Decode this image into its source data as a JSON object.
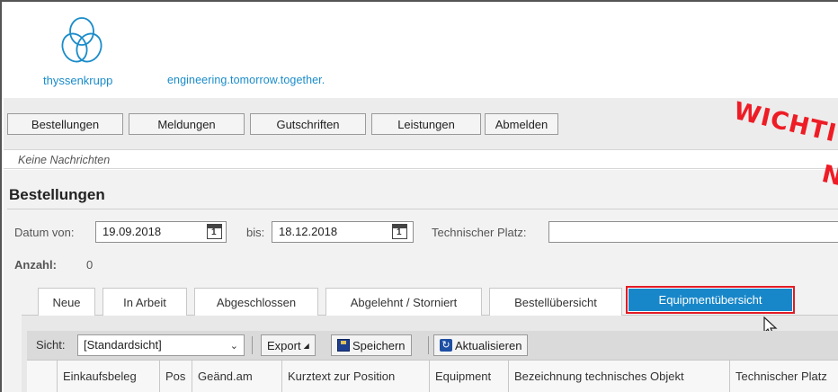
{
  "brand": {
    "name": "thyssenkrupp",
    "slogan": "engineering.tomorrow.together.",
    "color": "#1a8cc9"
  },
  "nav": {
    "items": [
      {
        "label": "Bestellungen"
      },
      {
        "label": "Meldungen"
      },
      {
        "label": "Gutschriften"
      },
      {
        "label": "Leistungen"
      },
      {
        "label": "Abmelden"
      }
    ]
  },
  "messages": {
    "text": "Keine Nachrichten"
  },
  "page": {
    "title": "Bestellungen"
  },
  "filters": {
    "date_from_label": "Datum von:",
    "date_from": "19.09.2018",
    "date_to_label": "bis:",
    "date_to": "18.12.2018",
    "calendar_day": "1",
    "tech_place_label": "Technischer Platz:",
    "tech_place_value": ""
  },
  "count": {
    "label": "Anzahl:",
    "value": "0"
  },
  "tabs": [
    {
      "label": "Neue"
    },
    {
      "label": "In Arbeit"
    },
    {
      "label": "Abgeschlossen"
    },
    {
      "label": "Abgelehnt / Storniert"
    },
    {
      "label": "Bestellübersicht"
    },
    {
      "label": "Equipmentübersicht",
      "active": true
    }
  ],
  "toolbar": {
    "view_label": "Sicht:",
    "view_value": "[Standardsicht]",
    "export_label": "Export",
    "save_label": "Speichern",
    "refresh_label": "Aktualisieren"
  },
  "table": {
    "columns": [
      "",
      "Einkaufsbeleg",
      "Pos",
      "Geänd.am",
      "Kurztext zur Position",
      "Equipment",
      "Bezeichnung technisches Objekt",
      "Technischer Platz"
    ]
  },
  "watermark": {
    "line1": "WICHTI",
    "line2": "N"
  },
  "colors": {
    "accent": "#1887c9",
    "highlight": "#e21b25",
    "watermark": "#ee1c25"
  }
}
